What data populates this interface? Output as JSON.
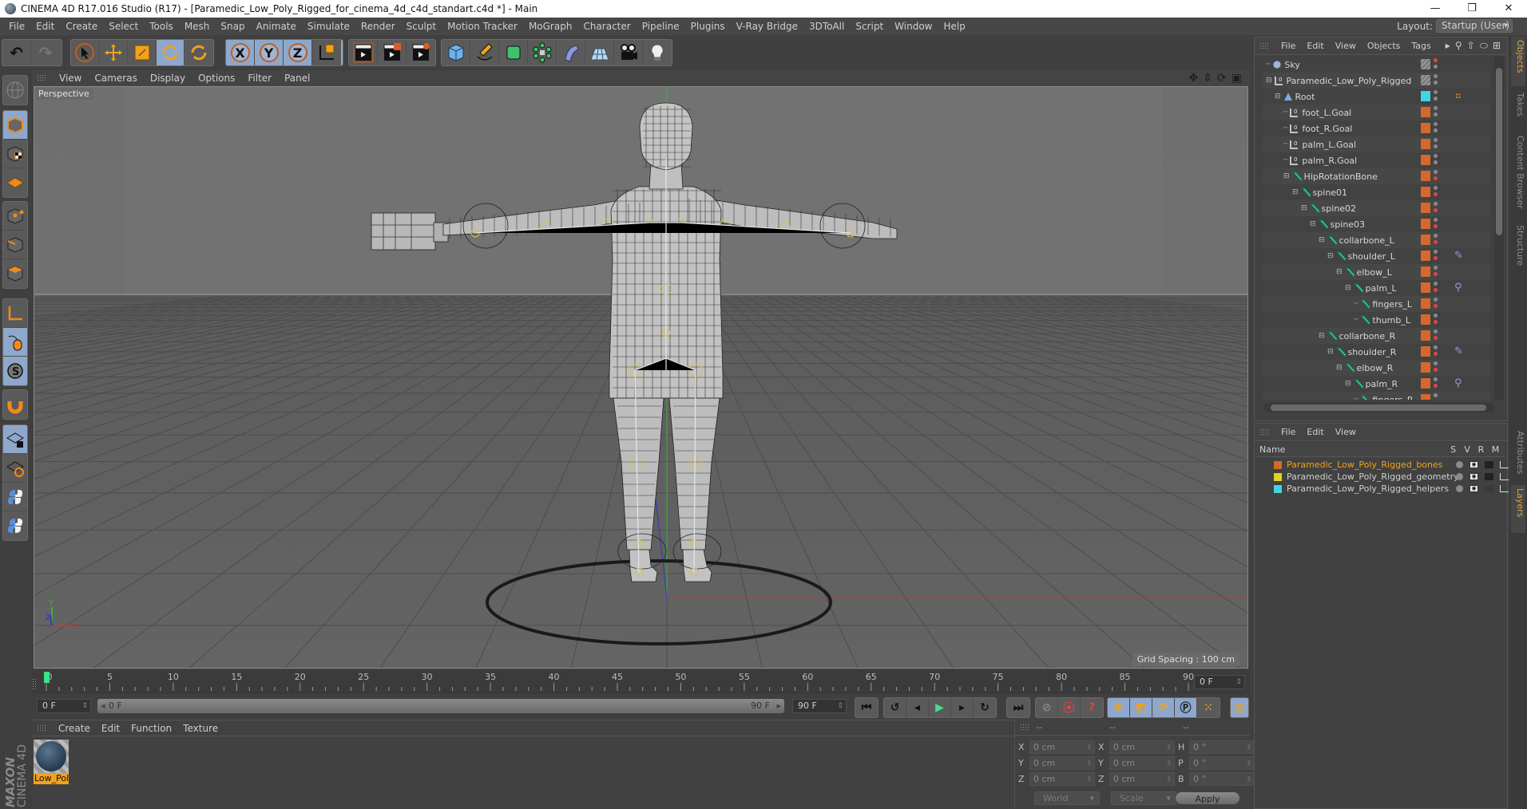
{
  "window": {
    "title": "CINEMA 4D R17.016 Studio (R17) - [Paramedic_Low_Poly_Rigged_for_cinema_4d_c4d_standart.c4d *] - Main",
    "controls": [
      "—",
      "❐",
      "✕"
    ]
  },
  "menubar": {
    "items": [
      "File",
      "Edit",
      "Create",
      "Select",
      "Tools",
      "Mesh",
      "Snap",
      "Animate",
      "Simulate",
      "Render",
      "Sculpt",
      "Motion Tracker",
      "MoGraph",
      "Character",
      "Pipeline",
      "Plugins",
      "V-Ray Bridge",
      "3DToAll",
      "Script",
      "Window",
      "Help"
    ],
    "layout_label": "Layout:",
    "layout_value": "Startup (User)"
  },
  "toolbar": {
    "undo": "undo-icon",
    "redo": "redo-icon",
    "tools": [
      "live-selection",
      "move",
      "scale",
      "rotate",
      "recent-tool"
    ],
    "axes": [
      "X",
      "Y",
      "Z"
    ],
    "coordinate_system": "world-coordinate-icon",
    "render": [
      "render-view",
      "render-picture-viewer",
      "render-settings"
    ],
    "create": [
      "cube",
      "pen-spline",
      "subdivision-surface",
      "array-cloner",
      "deformer-bend",
      "floor",
      "camera",
      "light"
    ]
  },
  "left_tools": [
    "make-editable",
    "model-mode",
    "texture-mode",
    "workplane-mode",
    "points-mode",
    "edges-mode",
    "polygons-mode",
    "axis-mode",
    "tweak-mode",
    "solo-mode",
    "snap",
    "workplane-lock",
    "workplane-align",
    "python-1",
    "python-2"
  ],
  "viewport": {
    "menu": [
      "View",
      "Cameras",
      "Display",
      "Options",
      "Filter",
      "Panel"
    ],
    "camera_label": "Perspective",
    "grid_spacing": "Grid Spacing : 100 cm",
    "axis_labels": {
      "x": "X",
      "y": "Y",
      "z": "Z"
    },
    "nav_icons": [
      "move-view-icon",
      "dolly-view-icon",
      "rotate-view-icon",
      "maximize-view-icon"
    ]
  },
  "timeline": {
    "ticks": [
      0,
      5,
      10,
      15,
      20,
      25,
      30,
      35,
      40,
      45,
      50,
      55,
      60,
      65,
      70,
      75,
      80,
      85,
      90
    ],
    "current_frame": "0 F",
    "start_frame": "0 F",
    "range_start": "0 F",
    "range_end": "90 F",
    "end_frame": "90 F",
    "playhead": 0
  },
  "material_manager": {
    "menu": [
      "Create",
      "Edit",
      "Function",
      "Texture"
    ],
    "materials": [
      {
        "name": "Low_Pol"
      }
    ]
  },
  "coordinates": {
    "headers": [
      "--",
      "--",
      "--"
    ],
    "rows": [
      {
        "l1": "X",
        "v1": "0 cm",
        "l2": "X",
        "v2": "0 cm",
        "l3": "H",
        "v3": "0 °"
      },
      {
        "l1": "Y",
        "v1": "0 cm",
        "l2": "Y",
        "v2": "0 cm",
        "l3": "P",
        "v3": "0 °"
      },
      {
        "l1": "Z",
        "v1": "0 cm",
        "l2": "Z",
        "v2": "0 cm",
        "l3": "B",
        "v3": "0 °"
      }
    ],
    "space": "World",
    "mode": "Scale",
    "apply": "Apply"
  },
  "object_manager": {
    "menu": [
      "File",
      "Edit",
      "View",
      "Objects",
      "Tags"
    ],
    "objects": [
      {
        "name": "Sky",
        "depth": 0,
        "type": "sky",
        "color": "",
        "tag": ""
      },
      {
        "name": "Paramedic_Low_Poly_Rigged",
        "depth": 0,
        "type": "null",
        "color": "",
        "tag": ""
      },
      {
        "name": "Root",
        "depth": 1,
        "type": "joint-root",
        "color": "#3fd6e0",
        "tag": "constraint"
      },
      {
        "name": "foot_L.Goal",
        "depth": 2,
        "type": "null",
        "color": "#d4692a",
        "tag": ""
      },
      {
        "name": "foot_R.Goal",
        "depth": 2,
        "type": "null",
        "color": "#d4692a",
        "tag": ""
      },
      {
        "name": "palm_L.Goal",
        "depth": 2,
        "type": "null",
        "color": "#d4692a",
        "tag": ""
      },
      {
        "name": "palm_R.Goal",
        "depth": 2,
        "type": "null",
        "color": "#d4692a",
        "tag": ""
      },
      {
        "name": "HipRotationBone",
        "depth": 2,
        "type": "bone",
        "color": "#d4692a",
        "tag": ""
      },
      {
        "name": "spine01",
        "depth": 3,
        "type": "bone",
        "color": "#d4692a",
        "tag": ""
      },
      {
        "name": "spine02",
        "depth": 4,
        "type": "bone",
        "color": "#d4692a",
        "tag": ""
      },
      {
        "name": "spine03",
        "depth": 5,
        "type": "bone",
        "color": "#d4692a",
        "tag": ""
      },
      {
        "name": "collarbone_L",
        "depth": 6,
        "type": "bone",
        "color": "#d4692a",
        "tag": ""
      },
      {
        "name": "shoulder_L",
        "depth": 7,
        "type": "bone",
        "color": "#d4692a",
        "tag": "ik"
      },
      {
        "name": "elbow_L",
        "depth": 8,
        "type": "bone",
        "color": "#d4692a",
        "tag": ""
      },
      {
        "name": "palm_L",
        "depth": 9,
        "type": "bone",
        "color": "#d4692a",
        "tag": "psr"
      },
      {
        "name": "fingers_L",
        "depth": 10,
        "type": "bone",
        "color": "#d4692a",
        "tag": ""
      },
      {
        "name": "thumb_L",
        "depth": 10,
        "type": "bone",
        "color": "#d4692a",
        "tag": ""
      },
      {
        "name": "collarbone_R",
        "depth": 6,
        "type": "bone",
        "color": "#d4692a",
        "tag": ""
      },
      {
        "name": "shoulder_R",
        "depth": 7,
        "type": "bone",
        "color": "#d4692a",
        "tag": "ik"
      },
      {
        "name": "elbow_R",
        "depth": 8,
        "type": "bone",
        "color": "#d4692a",
        "tag": ""
      },
      {
        "name": "palm_R",
        "depth": 9,
        "type": "bone",
        "color": "#d4692a",
        "tag": "psr"
      },
      {
        "name": "fingers_R",
        "depth": 10,
        "type": "bone",
        "color": "#d4692a",
        "tag": ""
      }
    ]
  },
  "side_tabs_top": [
    "Objects",
    "Takes",
    "Content Browser",
    "Structure"
  ],
  "side_tabs_bottom": [
    "Attributes",
    "Layers"
  ],
  "layer_manager": {
    "menu": [
      "File",
      "Edit",
      "View"
    ],
    "columns": {
      "name": "Name",
      "s": "S",
      "v": "V",
      "r": "R",
      "m": "M"
    },
    "layers": [
      {
        "name": "Paramedic_Low_Poly_Rigged_bones",
        "color": "#d4692a",
        "text_color": "#f0a21c"
      },
      {
        "name": "Paramedic_Low_Poly_Rigged_geometry",
        "color": "#e0d21e",
        "text_color": "#cfcfcf"
      },
      {
        "name": "Paramedic_Low_Poly_Rigged_helpers",
        "color": "#3fd6e0",
        "text_color": "#cfcfcf"
      }
    ]
  },
  "branding": {
    "maxon": "MAXON",
    "product": "CINEMA 4D"
  },
  "colors": {
    "accent_blue": "#8ea7cc",
    "accent_orange": "#e7a23a",
    "panel": "#414141"
  }
}
